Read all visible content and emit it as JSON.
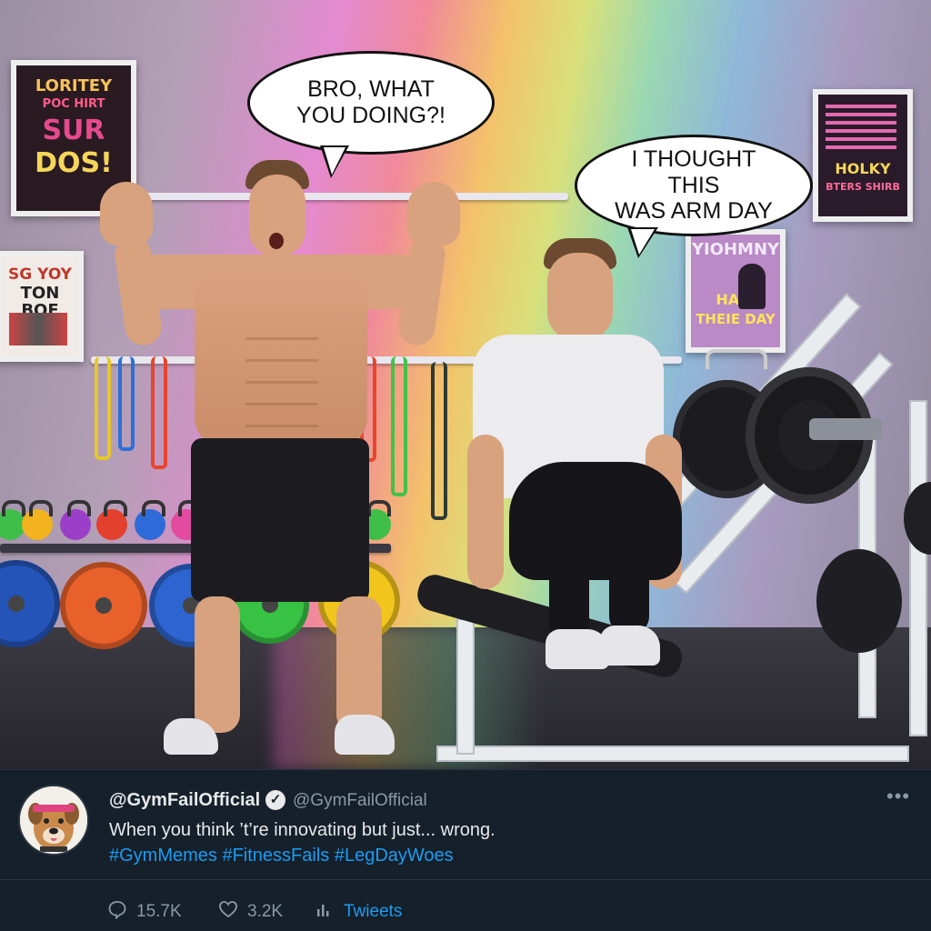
{
  "scene": {
    "bubble_left": "BRO, WHAT\nYOU DOING?!",
    "bubble_right": "I THOUGHT THIS\nWAS ARM DAY",
    "posters": [
      {
        "lines": [
          "LORITEY",
          "POC HIRT",
          "SUR",
          "DOS!"
        ]
      },
      {
        "lines": [
          "SG YOY",
          "TON BOF"
        ]
      },
      {
        "lines": [
          "YIOHMNY",
          "HAIS",
          "THEIE DAY"
        ]
      },
      {
        "lines": [
          "HOLKY",
          "BTERS SHIRB"
        ]
      }
    ]
  },
  "tweet": {
    "display_name": "@GymFailOfficial",
    "handle": "@GymFailOfficial",
    "verified_icon": "verified-badge-icon",
    "more_label": "•••",
    "text": "When you think ’t’re innovating but just... wrong.",
    "hashtags": "#GymMemes #FitnessFails #LegDayWoes",
    "replies": "15.7K",
    "likes": "3.2K",
    "retweets_label": "Twieets"
  }
}
